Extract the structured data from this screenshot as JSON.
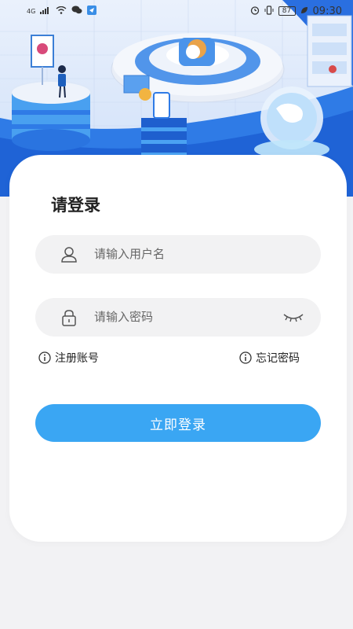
{
  "status_bar": {
    "network": "4G",
    "battery": "87",
    "time": "09:30"
  },
  "login": {
    "title": "请登录",
    "username_placeholder": "请输入用户名",
    "password_placeholder": "请输入密码",
    "register_label": "注册账号",
    "forgot_label": "忘记密码",
    "submit_label": "立即登录"
  },
  "icons": {
    "user": "user-icon",
    "lock": "lock-icon",
    "eye_closed": "eye-closed-icon",
    "info": "info-icon"
  },
  "colors": {
    "accent": "#3aa6f3",
    "hero_blue": "#2f7be6",
    "card_bg": "#ffffff",
    "page_bg": "#f2f2f4",
    "field_bg": "#f2f2f3"
  }
}
